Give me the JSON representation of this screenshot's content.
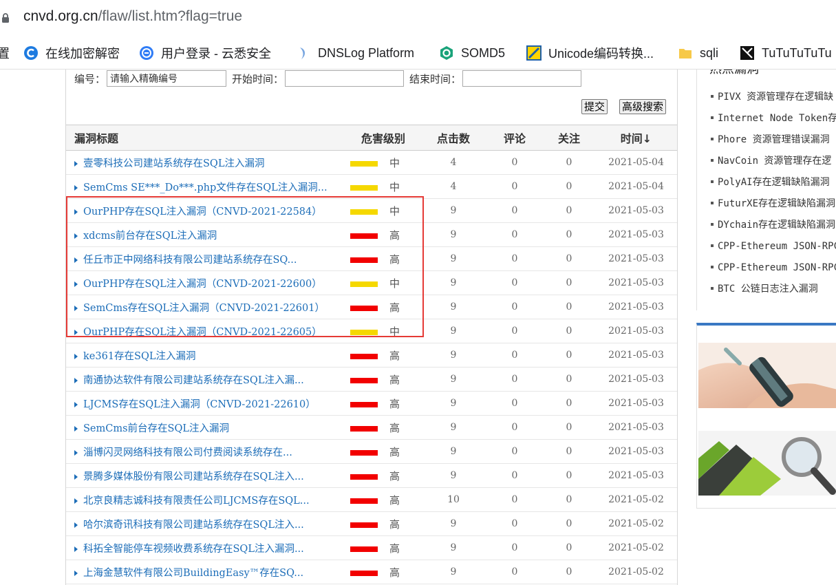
{
  "browser": {
    "url_host": "cnvd.org.cn",
    "url_path": "/flaw/list.htm?flag=true",
    "bookmarks": [
      {
        "label": "置",
        "icon": "partial-icon"
      },
      {
        "label": "在线加密解密",
        "icon": "c-logo-icon"
      },
      {
        "label": "用户登录 - 云悉安全",
        "icon": "yunxi-logo-icon"
      },
      {
        "label": "DNSLog Platform",
        "icon": "dnslog-logo-icon"
      },
      {
        "label": "SOMD5",
        "icon": "somd5-logo-icon"
      },
      {
        "label": "Unicode编码转换...",
        "icon": "unicode-logo-icon"
      },
      {
        "label": "sqli",
        "icon": "folder-icon"
      },
      {
        "label": "TuTuTuTuTu",
        "icon": "tutu-logo-icon"
      }
    ]
  },
  "search": {
    "id_label": "编号：",
    "id_value": "请输入精确编号",
    "start_label": "开始时间：",
    "end_label": "结束时间：",
    "submit_label": "提交",
    "advanced_label": "高级搜索"
  },
  "table": {
    "headers": {
      "title": "漏洞标题",
      "severity": "危害级别",
      "clicks": "点击数",
      "comments": "评论",
      "follows": "关注",
      "time": "时间↓"
    },
    "rows": [
      {
        "title": "壹零科技公司建站系统存在SQL注入漏洞",
        "level": "中",
        "clicks": "4",
        "comments": "0",
        "follows": "0",
        "date": "2021-05-04"
      },
      {
        "title": "SemCms SE***_Do***.php文件存在SQL注入漏洞...",
        "level": "中",
        "clicks": "4",
        "comments": "0",
        "follows": "0",
        "date": "2021-05-04"
      },
      {
        "title": "OurPHP存在SQL注入漏洞（CNVD-2021-22584）",
        "level": "中",
        "clicks": "9",
        "comments": "0",
        "follows": "0",
        "date": "2021-05-03"
      },
      {
        "title": "xdcms前台存在SQL注入漏洞",
        "level": "高",
        "clicks": "9",
        "comments": "0",
        "follows": "0",
        "date": "2021-05-03"
      },
      {
        "title": "任丘市正中网络科技有限公司建站系统存在SQ...",
        "level": "高",
        "clicks": "9",
        "comments": "0",
        "follows": "0",
        "date": "2021-05-03"
      },
      {
        "title": "OurPHP存在SQL注入漏洞（CNVD-2021-22600）",
        "level": "中",
        "clicks": "9",
        "comments": "0",
        "follows": "0",
        "date": "2021-05-03"
      },
      {
        "title": "SemCms存在SQL注入漏洞（CNVD-2021-22601）",
        "level": "高",
        "clicks": "9",
        "comments": "0",
        "follows": "0",
        "date": "2021-05-03"
      },
      {
        "title": "OurPHP存在SQL注入漏洞（CNVD-2021-22605）",
        "level": "中",
        "clicks": "9",
        "comments": "0",
        "follows": "0",
        "date": "2021-05-03"
      },
      {
        "title": "ke361存在SQL注入漏洞",
        "level": "高",
        "clicks": "9",
        "comments": "0",
        "follows": "0",
        "date": "2021-05-03"
      },
      {
        "title": "南通协达软件有限公司建站系统存在SQL注入漏...",
        "level": "高",
        "clicks": "9",
        "comments": "0",
        "follows": "0",
        "date": "2021-05-03"
      },
      {
        "title": "LJCMS存在SQL注入漏洞（CNVD-2021-22610）",
        "level": "高",
        "clicks": "9",
        "comments": "0",
        "follows": "0",
        "date": "2021-05-03"
      },
      {
        "title": "SemCms前台存在SQL注入漏洞",
        "level": "高",
        "clicks": "9",
        "comments": "0",
        "follows": "0",
        "date": "2021-05-03"
      },
      {
        "title": "淄博闪灵网络科技有限公司付费阅读系统存在...",
        "level": "高",
        "clicks": "9",
        "comments": "0",
        "follows": "0",
        "date": "2021-05-03"
      },
      {
        "title": "景腾多媒体股份有限公司建站系统存在SQL注入...",
        "level": "高",
        "clicks": "9",
        "comments": "0",
        "follows": "0",
        "date": "2021-05-03"
      },
      {
        "title": "北京良精志诚科技有限责任公司LJCMS存在SQL...",
        "level": "高",
        "clicks": "10",
        "comments": "0",
        "follows": "0",
        "date": "2021-05-02"
      },
      {
        "title": "哈尔滨奇讯科技有限公司建站系统存在SQL注入...",
        "level": "高",
        "clicks": "9",
        "comments": "0",
        "follows": "0",
        "date": "2021-05-02"
      },
      {
        "title": "科拓全智能停车视频收费系统存在SQL注入漏洞...",
        "level": "高",
        "clicks": "9",
        "comments": "0",
        "follows": "0",
        "date": "2021-05-02"
      },
      {
        "title": "上海金慧软件有限公司BuildingEasy™存在SQ...",
        "level": "高",
        "clicks": "9",
        "comments": "0",
        "follows": "0",
        "date": "2021-05-02"
      }
    ]
  },
  "colors": {
    "medium": "#f5d800",
    "high": "#f20000",
    "link": "#1c6db8",
    "highlight_box": "#e53935"
  },
  "sidebar": {
    "title": "热点漏洞",
    "items": [
      "PIVX 资源管理存在逻辑缺",
      "Internet Node Token存在",
      "Phore 资源管理错误漏洞",
      "NavCoin 资源管理存在逻",
      "PolyAI存在逻辑缺陷漏洞",
      "FuturXE存在逻辑缺陷漏洞",
      "DYchain存在逻辑缺陷漏洞",
      "CPP-Ethereum JSON-RPC存",
      "CPP-Ethereum JSON-RPC存",
      "BTC 公链日志注入漏洞"
    ]
  }
}
